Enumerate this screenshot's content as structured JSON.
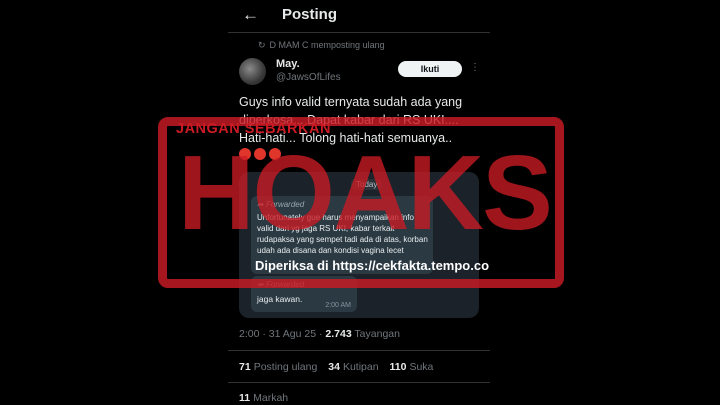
{
  "header": {
    "back_icon": "arrow-left-icon",
    "title": "Posting"
  },
  "repost": {
    "icon": "repost-icon",
    "text": "D MAM C memposting ulang"
  },
  "tweet": {
    "author_name": "May.",
    "author_handle": "@JawsOfLifes",
    "follow_label": "Ikuti",
    "more_icon": "more-vertical-icon",
    "text": "Guys info valid ternyata sudah ada yang diperkosa... Dapat kabar dari RS UKI.... Hati-hati... Tolong hati-hati semuanya..",
    "emoji_icon": "angry-face-icon"
  },
  "chat_screenshot": {
    "date": "Today",
    "forwarded_label": "Forwarded",
    "message_1": "Unfortunately gue harus menyampaikan info valid dari yg jaga RS UKI, kabar terkait rudapaksa yang sempet tadi ada di atas, korban udah ada disana dan kondisi vagina lecet",
    "message_2": "jaga kawan.",
    "time": "2:00 AM"
  },
  "meta": {
    "timestamp": "2:00 · 31 Agu 25 ·",
    "views_count": "2.743",
    "views_label": "Tayangan"
  },
  "stats": {
    "reposts_count": "71",
    "reposts_label": "Posting ulang",
    "quotes_count": "34",
    "quotes_label": "Kutipan",
    "likes_count": "110",
    "likes_label": "Suka",
    "bookmarks_count": "11",
    "bookmarks_label": "Markah"
  },
  "stamp": {
    "tagline": "JANGAN SEBARKAN",
    "word": "HOAKS",
    "footer": "Diperiksa di https://cekfakta.tempo.co",
    "color": "#cb1b24"
  }
}
